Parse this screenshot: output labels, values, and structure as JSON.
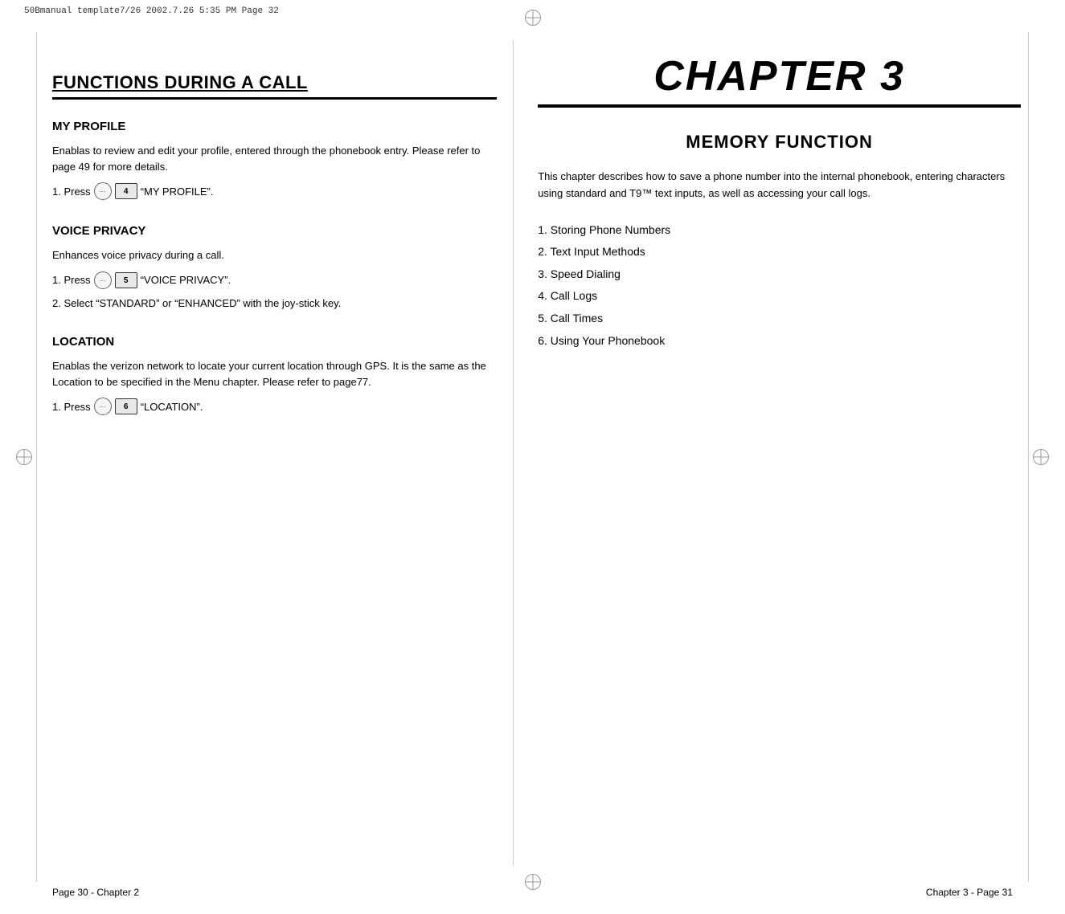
{
  "print_header": "50Bmanual template7/26  2002.7.26  5:35 PM  Page 32",
  "left": {
    "page_title": "FUNCTIONS DURING A CALL",
    "sections": [
      {
        "id": "my-profile",
        "heading": "MY PROFILE",
        "paragraphs": [
          "Enablas to review and edit your profile, entered through the phonebook entry. Please refer to page 49 for more details."
        ],
        "instructions": [
          {
            "text_before": "1. Press",
            "key_num": "4",
            "key_label": "4",
            "quoted": "“MY PROFILE”."
          }
        ]
      },
      {
        "id": "voice-privacy",
        "heading": "VOICE PRIVACY",
        "paragraphs": [
          "Enhances voice privacy during a call."
        ],
        "instructions": [
          {
            "text_before": "1. Press",
            "key_num": "5",
            "key_label": "5",
            "quoted": "“VOICE PRIVACY”."
          },
          {
            "text_plain": "2. Select “STANDARD” or “ENHANCED” with the joy-stick key."
          }
        ]
      },
      {
        "id": "location",
        "heading": "LOCATION",
        "paragraphs": [
          "Enablas the verizon network to locate your current location through GPS. It is the same as the Location to be specified in the Menu chapter. Please refer to page77."
        ],
        "instructions": [
          {
            "text_before": "1. Press",
            "key_num": "6",
            "key_label": "6",
            "quoted": "“LOCATION”."
          }
        ]
      }
    ]
  },
  "right": {
    "chapter_title": "CHAPTER 3",
    "section_heading": "MEMORY FUNCTION",
    "description": "This chapter describes how to save a phone number into the internal phonebook, entering characters using standard and T9™ text inputs, as well as accessing your call logs.",
    "toc": [
      "1. Storing Phone Numbers",
      "2. Text Input Methods",
      "3. Speed Dialing",
      "4. Call Logs",
      "5. Call Times",
      "6. Using Your Phonebook"
    ]
  },
  "footer": {
    "left": "Page 30 - Chapter 2",
    "right": "Chapter 3 - Page 31"
  }
}
